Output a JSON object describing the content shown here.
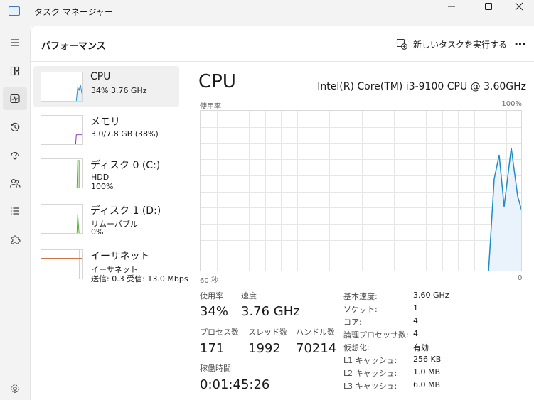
{
  "window": {
    "title": "タスク マネージャー"
  },
  "header": {
    "title": "パフォーマンス",
    "new_task_label": "新しいタスクを実行する",
    "more_label": "⋯"
  },
  "colors": {
    "cpu": "#1f8ccb",
    "memory": "#8a2bba",
    "disk": "#4caf2a",
    "ethernet": "#c9622a"
  },
  "perf_list": [
    {
      "name": "CPU",
      "line1": "34%  3.76 GHz",
      "line2": "",
      "line3": ""
    },
    {
      "name": "メモリ",
      "line1": "3.0/7.8 GB (38%)",
      "line2": "",
      "line3": ""
    },
    {
      "name": "ディスク 0 (C:)",
      "line1": "HDD",
      "line2": "100%",
      "line3": ""
    },
    {
      "name": "ディスク 1 (D:)",
      "line1": "リムーバブル",
      "line2": "0%",
      "line3": ""
    },
    {
      "name": "イーサネット",
      "line1": "イーサネット",
      "line2": "送信: 0.3  受信: 13.0 Mbps",
      "line3": ""
    }
  ],
  "detail": {
    "title": "CPU",
    "model": "Intel(R) Core(TM) i3-9100 CPU @ 3.60GHz",
    "graph_label": "使用率",
    "graph_max": "100%",
    "graph_time": "60 秒",
    "graph_min": "0",
    "stats": {
      "usage_label": "使用率",
      "usage_value": "34%",
      "speed_label": "速度",
      "speed_value": "3.76 GHz",
      "processes_label": "プロセス数",
      "processes_value": "171",
      "threads_label": "スレッド数",
      "threads_value": "1992",
      "handles_label": "ハンドル数",
      "handles_value": "70214",
      "uptime_label": "稼働時間",
      "uptime_value": "0:01:45:26"
    },
    "specs": [
      {
        "key": "基本速度:",
        "value": "3.60 GHz"
      },
      {
        "key": "ソケット:",
        "value": "1"
      },
      {
        "key": "コア:",
        "value": "4"
      },
      {
        "key": "論理プロセッサ数:",
        "value": "4"
      },
      {
        "key": "仮想化:",
        "value": "有効"
      },
      {
        "key": "L1 キャッシュ:",
        "value": "256 KB"
      },
      {
        "key": "L2 キャッシュ:",
        "value": "1.0 MB"
      },
      {
        "key": "L3 キャッシュ:",
        "value": "6.0 MB"
      }
    ]
  }
}
